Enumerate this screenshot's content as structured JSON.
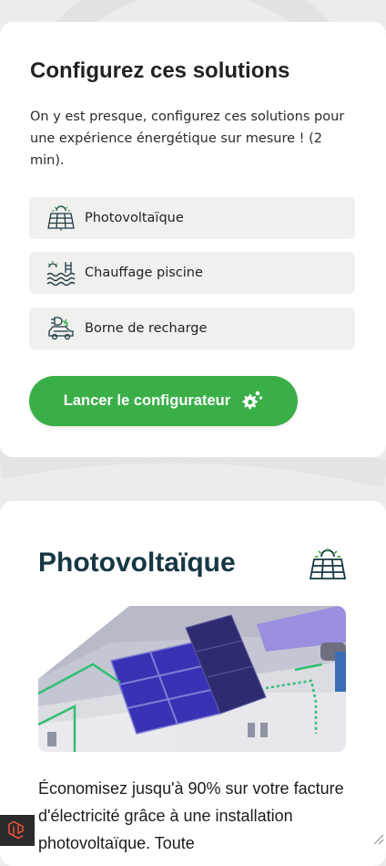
{
  "solutions_card": {
    "title": "Configurez ces solutions",
    "intro": "On y est presque, configurez ces solutions pour une expérience énergétique sur mesure ! (2 min).",
    "items": [
      {
        "label": "Photovoltaïque",
        "icon": "solar-panel-icon"
      },
      {
        "label": "Chauffage piscine",
        "icon": "pool-heating-icon"
      },
      {
        "label": "Borne de recharge",
        "icon": "ev-charger-icon"
      }
    ],
    "cta_label": "Lancer le configurateur",
    "cta_icon": "gears-icon"
  },
  "detail_card": {
    "title": "Photovoltaïque",
    "icon": "solar-panel-icon",
    "description": "Économisez jusqu'à 90% sur votre facture d'électricité grâce à une installation photovoltaïque. Toute"
  },
  "colors": {
    "accent_green": "#3aaf48",
    "title_dark": "#163743",
    "background": "#ececeb"
  }
}
